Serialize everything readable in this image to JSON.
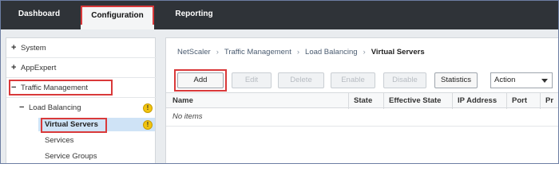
{
  "topnav": {
    "tabs": [
      {
        "label": "Dashboard"
      },
      {
        "label": "Configuration"
      },
      {
        "label": "Reporting"
      }
    ]
  },
  "tree": {
    "items": [
      {
        "symbol": "+",
        "label": "System"
      },
      {
        "symbol": "+",
        "label": "AppExpert"
      },
      {
        "symbol": "−",
        "label": "Traffic Management"
      },
      {
        "symbol": "−",
        "label": "Load Balancing"
      },
      {
        "label": "Virtual Servers"
      },
      {
        "label": "Services"
      },
      {
        "label": "Service Groups"
      }
    ],
    "warning_glyph": "!"
  },
  "breadcrumb": {
    "items": [
      "NetScaler",
      "Traffic Management",
      "Load Balancing",
      "Virtual Servers"
    ],
    "separator": "›"
  },
  "toolbar": {
    "add": "Add",
    "edit": "Edit",
    "delete": "Delete",
    "enable": "Enable",
    "disable": "Disable",
    "statistics": "Statistics",
    "action_select": "Action"
  },
  "table": {
    "columns": [
      "Name",
      "State",
      "Effective State",
      "IP Address",
      "Port",
      "Pr"
    ],
    "empty_text": "No items"
  },
  "colors": {
    "nav_bg": "#2f3338",
    "highlight_red": "#d9393a",
    "selected_bg": "#cfe3f6",
    "warning_yellow": "#f2c40f"
  }
}
